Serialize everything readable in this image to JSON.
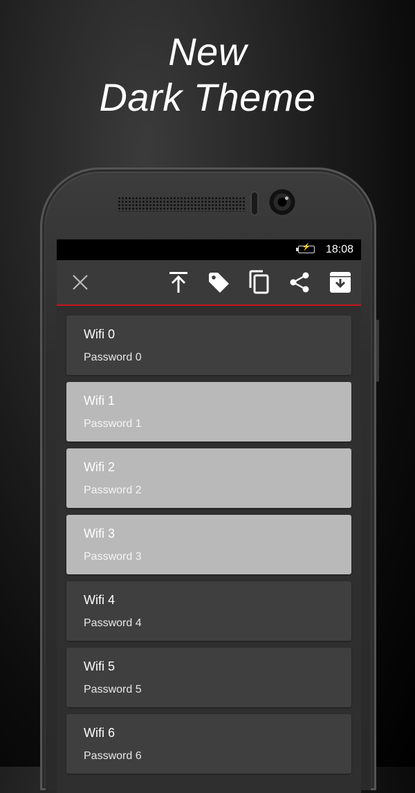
{
  "headline": {
    "line1": "New",
    "line2": "Dark Theme"
  },
  "statusbar": {
    "time": "18:08",
    "battery_icon": "battery-charging-icon"
  },
  "toolbar": {
    "actions": [
      {
        "name": "close-icon"
      },
      {
        "name": "move-to-top-icon"
      },
      {
        "name": "tag-icon"
      },
      {
        "name": "copy-icon"
      },
      {
        "name": "share-icon"
      },
      {
        "name": "archive-icon"
      }
    ],
    "accent_color": "#c6141c"
  },
  "items": [
    {
      "name": "Wifi 0",
      "password": "Password 0",
      "selected": false
    },
    {
      "name": "Wifi 1",
      "password": "Password 1",
      "selected": true
    },
    {
      "name": "Wifi 2",
      "password": "Password 2",
      "selected": true
    },
    {
      "name": "Wifi 3",
      "password": "Password 3",
      "selected": true
    },
    {
      "name": "Wifi 4",
      "password": "Password 4",
      "selected": false
    },
    {
      "name": "Wifi 5",
      "password": "Password 5",
      "selected": false
    },
    {
      "name": "Wifi 6",
      "password": "Password 6",
      "selected": false
    }
  ]
}
